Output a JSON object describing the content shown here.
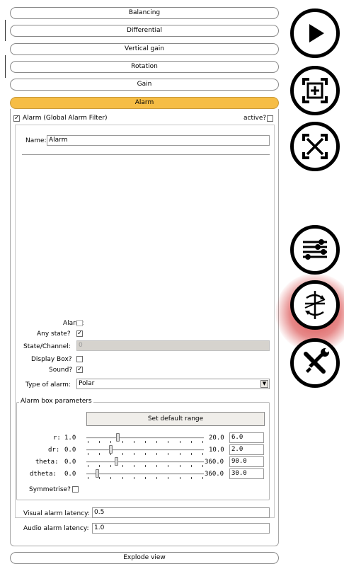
{
  "sections": {
    "balancing": "Balancing",
    "differential": "Differential",
    "vertical_gain": "Vertical gain",
    "rotation": "Rotation",
    "gain": "Gain",
    "alarm": "Alarm",
    "explode_view": "Explode view"
  },
  "alarm_panel": {
    "header_label": "Alarm (Global Alarm Filter)",
    "header_checked": true,
    "active_label": "active?",
    "active_checked": false,
    "name_label": "Name:",
    "name_value": "Alarm",
    "alarm_label": "Alarm:",
    "alarm_checked": false,
    "any_state_label": "Any state?",
    "any_state_checked": true,
    "state_channel_label": "State/Channel:",
    "state_channel_value": "0",
    "display_box_label": "Display Box?",
    "display_box_checked": false,
    "sound_label": "Sound?",
    "sound_checked": true,
    "type_label": "Type of alarm:",
    "type_value": "Polar",
    "box_params": {
      "title": "Alarm box parameters",
      "set_default_label": "Set default range",
      "sliders": [
        {
          "label": "r:",
          "min": "1.0",
          "max": "20.0",
          "value": "6.0",
          "fraction": 0.26
        },
        {
          "label": "dr:",
          "min": "0.0",
          "max": "10.0",
          "value": "2.0",
          "fraction": 0.2
        },
        {
          "label": "theta:",
          "min": "0.0",
          "max": "360.0",
          "value": "90.0",
          "fraction": 0.25
        },
        {
          "label": "dtheta:",
          "min": "0.0",
          "max": "360.0",
          "value": "30.0",
          "fraction": 0.08
        }
      ],
      "symmetrise_label": "Symmetrise?",
      "symmetrise_checked": false
    },
    "visual_latency_label": "Visual alarm latency:",
    "visual_latency_value": "0.5",
    "audio_latency_label": "Audio alarm latency:",
    "audio_latency_value": "1.0"
  },
  "side_buttons": [
    {
      "icon": "play-icon"
    },
    {
      "icon": "fit-view-icon"
    },
    {
      "icon": "expand-icon"
    },
    {
      "icon": "sliders-icon"
    },
    {
      "icon": "axis-rotate-icon",
      "highlighted": true
    },
    {
      "icon": "tools-icon"
    }
  ],
  "colors": {
    "active_section": "#f6bd45",
    "highlight_glow": "#d22828"
  }
}
